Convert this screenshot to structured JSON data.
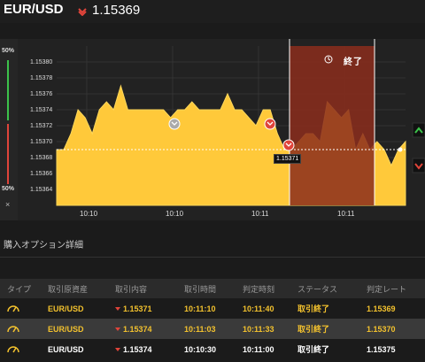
{
  "header": {
    "pair": "EUR/USD",
    "price": "1.15369",
    "direction_icon": "down-arrow-icon",
    "down_color": "#e0443a"
  },
  "chart": {
    "percent_top": "50%",
    "percent_bottom": "50%",
    "side_close": "×",
    "end_label": "終了",
    "current_price_tag": "1.15371",
    "colors": {
      "area": "#ffc93a",
      "ended_overlay": "#8b2d1c",
      "up": "#3cc24a",
      "down": "#e0443a"
    }
  },
  "chart_data": {
    "type": "area",
    "y_ticks": [
      "1.15380",
      "1.15378",
      "1.15376",
      "1.15374",
      "1.15372",
      "1.15370",
      "1.15368",
      "1.15366",
      "1.15364"
    ],
    "x_ticks": [
      "10:10",
      "10:10",
      "10:11",
      "10:11"
    ],
    "ylim": [
      1.15362,
      1.15382
    ],
    "current": 1.15369,
    "series": [
      {
        "values": [
          1.15369,
          1.15369,
          1.15371,
          1.15374,
          1.15373,
          1.15371,
          1.15374,
          1.15375,
          1.15374,
          1.15377,
          1.15374,
          1.15374,
          1.15374,
          1.15374,
          1.15374,
          1.15374,
          1.15373,
          1.15374,
          1.15374,
          1.15375,
          1.15374,
          1.15374,
          1.15374,
          1.15374,
          1.15376,
          1.15374,
          1.15374,
          1.15373,
          1.15372,
          1.15374,
          1.15374,
          1.15371,
          1.15369,
          1.15369,
          1.1537,
          1.15371,
          1.15371,
          1.1537,
          1.15375,
          1.15374,
          1.15373,
          1.15374,
          1.15369,
          1.15371,
          1.15369,
          1.1537,
          1.15369,
          1.15367,
          1.15369,
          1.1537
        ]
      }
    ],
    "markers": [
      {
        "label": "1.15371"
      },
      {
        "label": "1.15374"
      },
      {
        "label": "1.15374"
      }
    ]
  },
  "details": {
    "title": "購入オプション詳細",
    "columns": [
      "タイプ",
      "取引原資産",
      "取引内容",
      "取引時間",
      "判定時刻",
      "ステータス",
      "判定レート"
    ],
    "rows": [
      {
        "type_icon": "gauge-icon",
        "asset": "EUR/USD",
        "content": "1.15371",
        "trade_time": "10:11:10",
        "judge_time": "10:11:40",
        "status": "取引終了",
        "rate": "1.15369"
      },
      {
        "type_icon": "gauge-icon",
        "asset": "EUR/USD",
        "content": "1.15374",
        "trade_time": "10:11:03",
        "judge_time": "10:11:33",
        "status": "取引終了",
        "rate": "1.15370"
      },
      {
        "type_icon": "gauge-icon",
        "asset": "EUR/USD",
        "content": "1.15374",
        "trade_time": "10:10:30",
        "judge_time": "10:11:00",
        "status": "取引終了",
        "rate": "1.15375"
      }
    ]
  }
}
